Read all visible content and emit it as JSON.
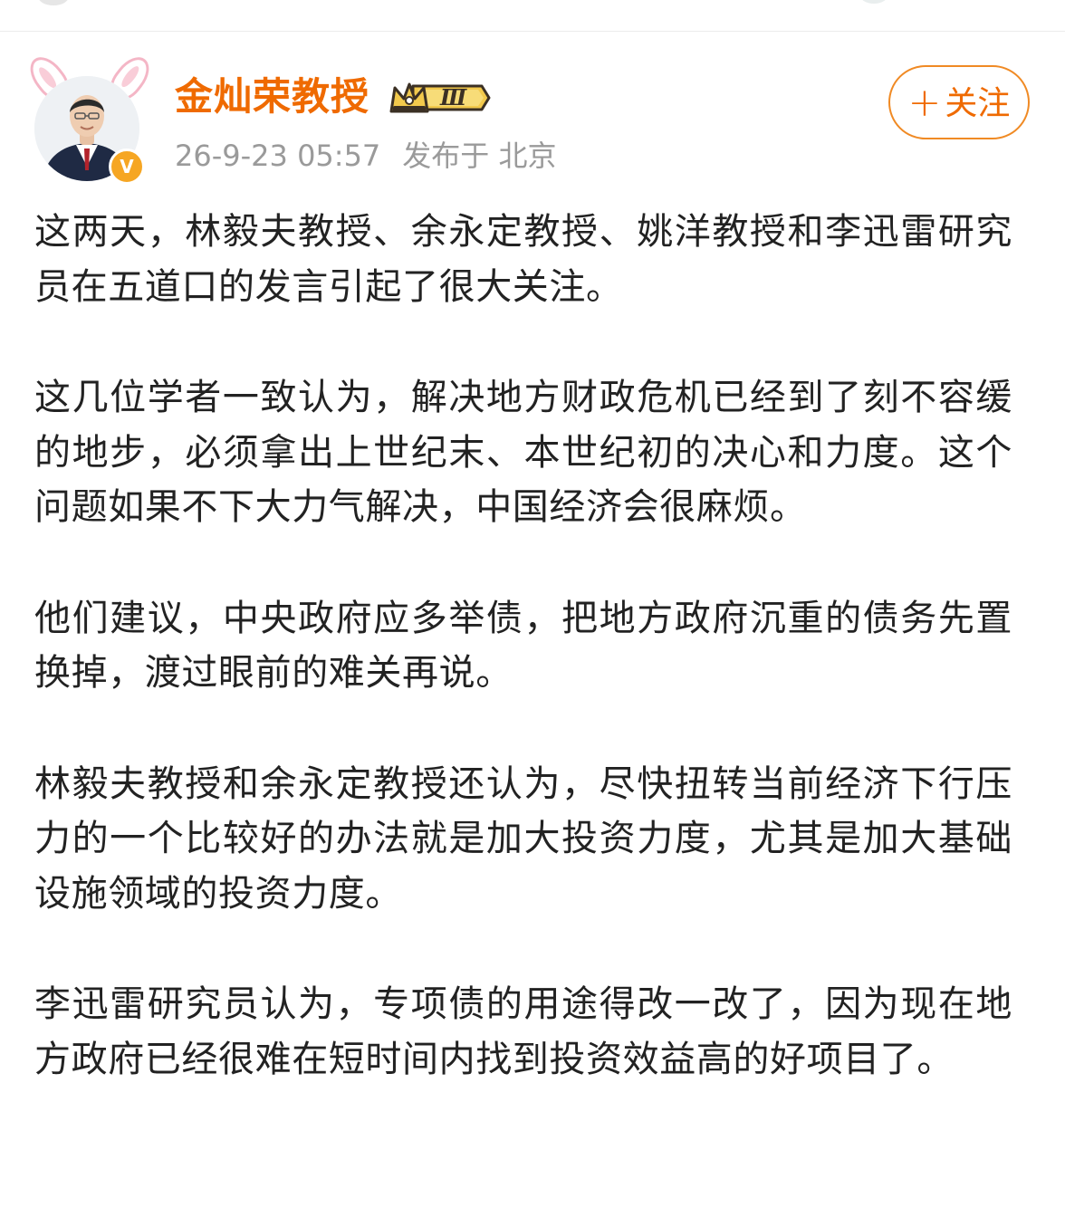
{
  "post": {
    "author": {
      "name": "金灿荣教授",
      "vip_level": "Ⅲ",
      "verified_mark": "V"
    },
    "meta": {
      "timestamp": "26-9-23 05:57",
      "location": "发布于 北京"
    },
    "follow_button": {
      "plus": "+",
      "label": "关注"
    },
    "paragraphs": [
      "这两天，林毅夫教授、余永定教授、姚洋教授和李迅雷研究员在五道口的发言引起了很大关注。",
      "这几位学者一致认为，解决地方财政危机已经到了刻不容缓的地步，必须拿出上世纪末、本世纪初的决心和力度。这个问题如果不下大力气解决，中国经济会很麻烦。",
      "他们建议，中央政府应多举债，把地方政府沉重的债务先置换掉，渡过眼前的难关再说。",
      "林毅夫教授和余永定教授还认为，尽快扭转当前经济下行压力的一个比较好的办法就是加大投资力度，尤其是加大基础设施领域的投资力度。",
      "李迅雷研究员认为，专项债的用途得改一改了，因为现在地方政府已经很难在短时间内找到投资效益高的好项目了。"
    ]
  },
  "colors": {
    "accent_orange": "#ef6a00",
    "follow_border": "#f08a24",
    "meta_gray": "#9a9a9a",
    "body_text": "#222222",
    "verified_badge": "#f6a623",
    "vip_gold": "#f2c94c"
  },
  "icons": {
    "avatar_decoration": "bunny-ears",
    "verified": "verified-badge-icon",
    "vip": "crown-vip-badge-icon"
  }
}
